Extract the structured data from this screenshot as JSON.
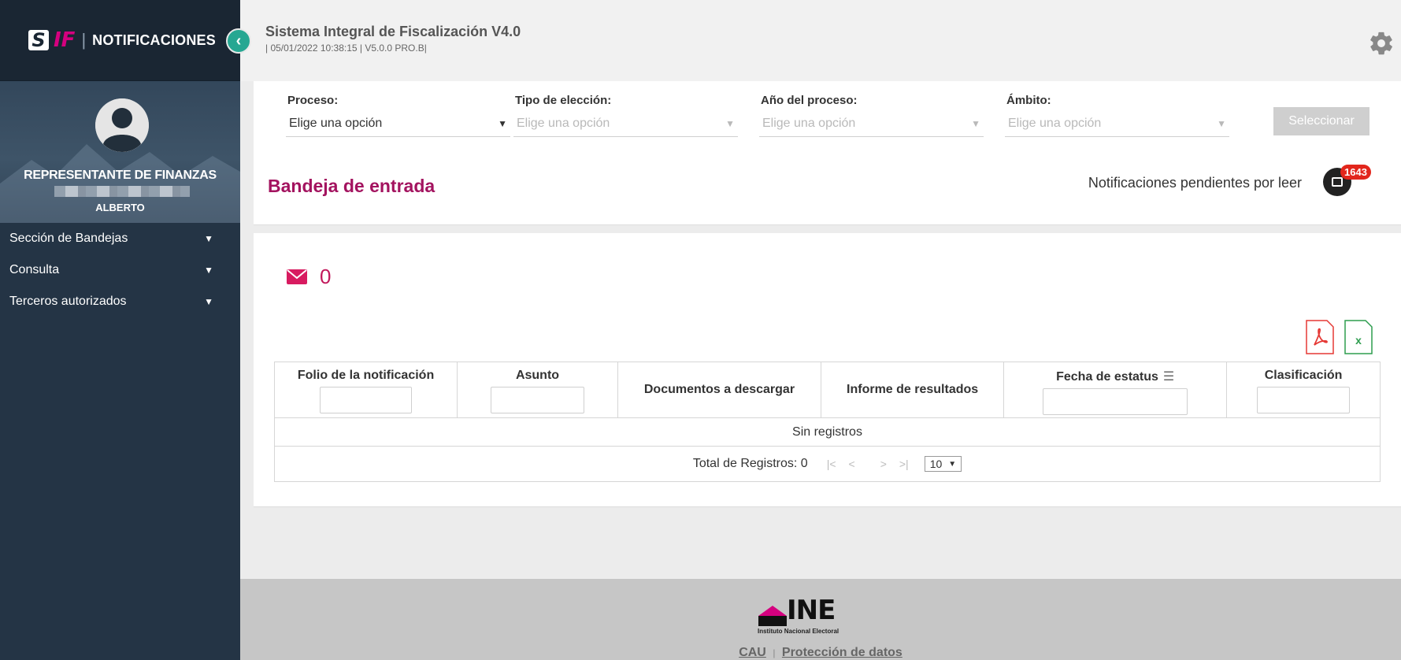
{
  "sidebar": {
    "logo_s": "S",
    "logo_if": "IF",
    "logo_separator": "|",
    "title": "NOTIFICACIONES",
    "collapse_symbol": "‹",
    "role": "REPRESENTANTE DE FINANZAS",
    "user_first_name": "ALBERTO",
    "nav": [
      {
        "label": "Sección de Bandejas"
      },
      {
        "label": "Consulta"
      },
      {
        "label": "Terceros autorizados"
      }
    ]
  },
  "header": {
    "system_title": "Sistema Integral de Fiscalización V4.0",
    "subtitle": "| 05/01/2022 10:38:15 | V5.0.0 PRO.B|"
  },
  "filters": [
    {
      "label": "Proceso:",
      "value": "Elige una opción",
      "disabled": false
    },
    {
      "label": "Tipo de elección:",
      "value": "Elige una opción",
      "disabled": true
    },
    {
      "label": "Año del proceso:",
      "value": "Elige una opción",
      "disabled": true
    },
    {
      "label": "Ámbito:",
      "value": "Elige una opción",
      "disabled": true
    }
  ],
  "select_button": "Seleccionar",
  "inbox": {
    "title": "Bandeja de entrada",
    "pending_label": "Notificaciones pendientes por leer",
    "pending_count": "1643",
    "mail_count": "0"
  },
  "table": {
    "columns": [
      {
        "label": "Folio de la notificación"
      },
      {
        "label": "Asunto"
      },
      {
        "label": "Documentos a descargar"
      },
      {
        "label": "Informe de resultados"
      },
      {
        "label": "Fecha de estatus"
      },
      {
        "label": "Clasificación"
      }
    ],
    "empty_message": "Sin registros",
    "total_label": "Total de Registros: 0",
    "page_size": "10",
    "pager_first": "|<",
    "pager_prev": "<",
    "pager_next": ">",
    "pager_last": ">|"
  },
  "footer": {
    "brand": "INE",
    "brand_full": "Instituto Nacional Electoral",
    "link_cau": "CAU",
    "link_separator": "|",
    "link_privacy": "Protección de datos"
  },
  "colors": {
    "sidebar_bg": "#243445",
    "accent_teal": "#26a792",
    "accent_magenta": "#a3135f",
    "badge_red": "#e2261c"
  }
}
